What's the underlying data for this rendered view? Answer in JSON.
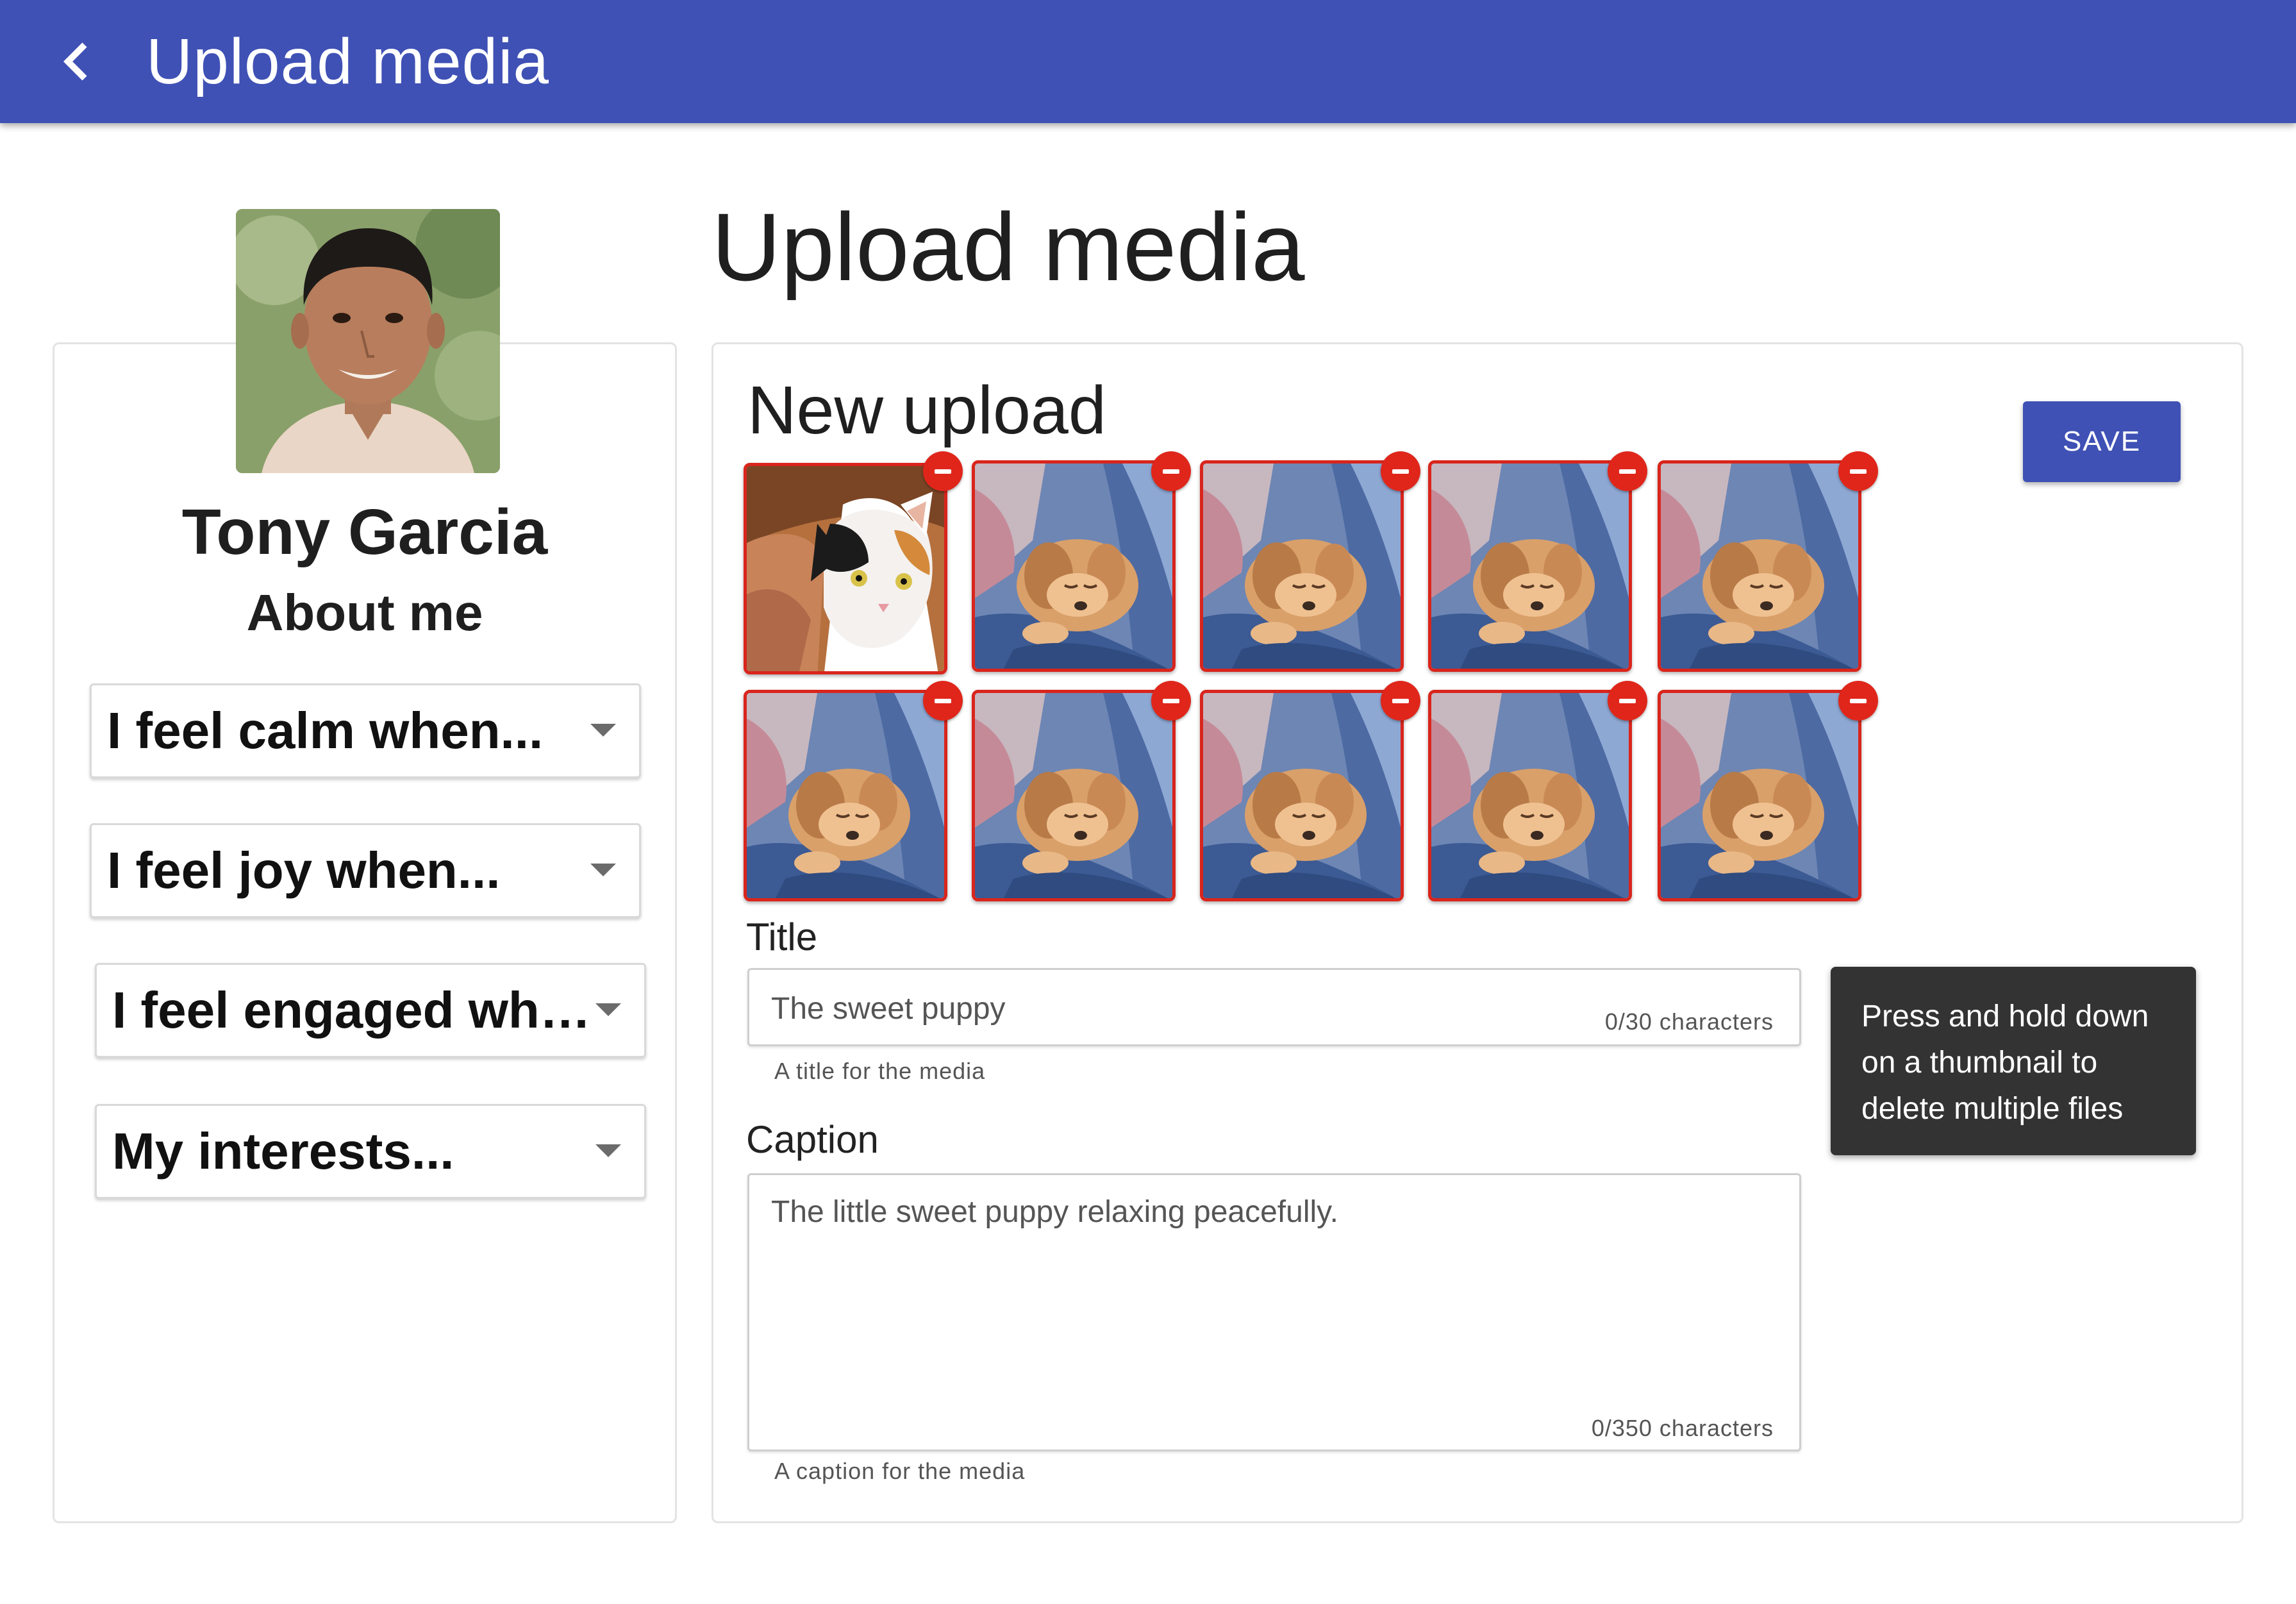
{
  "appbar": {
    "title": "Upload media",
    "back_icon": "chevron-left-icon",
    "color": "#3f51b5"
  },
  "profile": {
    "name": "Tony Garcia",
    "about_heading": "About me",
    "avatar_icon": "profile-photo",
    "selects": [
      {
        "label": "I feel calm when..."
      },
      {
        "label": "I feel joy when..."
      },
      {
        "label": "I feel engaged when..."
      },
      {
        "label": "My interests..."
      }
    ]
  },
  "main": {
    "heading": "Upload media",
    "upload_heading": "New upload",
    "save_label": "SAVE",
    "accent_color": "#3f51b5",
    "thumbnail_border_color": "#d9251c",
    "thumbnails": [
      {
        "subject": "cat"
      },
      {
        "subject": "puppy"
      },
      {
        "subject": "puppy"
      },
      {
        "subject": "puppy"
      },
      {
        "subject": "puppy"
      },
      {
        "subject": "puppy"
      },
      {
        "subject": "puppy"
      },
      {
        "subject": "puppy"
      },
      {
        "subject": "puppy"
      },
      {
        "subject": "puppy"
      }
    ],
    "title_field": {
      "label": "Title",
      "placeholder": "The sweet puppy",
      "value": "",
      "counter": "0/30 characters",
      "helper": "A title for the media"
    },
    "caption_field": {
      "label": "Caption",
      "placeholder": "The little sweet puppy relaxing peacefully.",
      "value": "",
      "counter": "0/350 characters",
      "helper": "A caption for the media"
    },
    "tooltip": {
      "line1": "Press and hold down",
      "line2": "on a thumbnail to",
      "line3": "delete multiple files"
    }
  }
}
